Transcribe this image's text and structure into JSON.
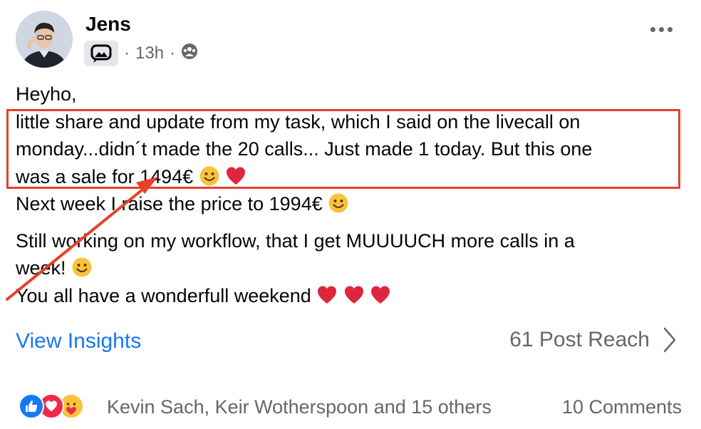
{
  "post": {
    "author": "Jens",
    "time": "13h",
    "separator": "·",
    "lines": {
      "greeting": "Heyho,",
      "line1": "little share and update from my task, which I said on the livecall on",
      "line2": "monday...didn´t made the 20 calls... Just made 1 today. But this one",
      "line3": "was a sale for 1494€",
      "line4": "Next week I raise the price to 1994€",
      "line5a": "Still working on my workflow, that I get MUUUUCH more calls in a",
      "line5b": "week!",
      "line6": "You all have a wonderfull  weekend"
    },
    "icons": [
      "group-icon",
      "audience-icon",
      "more-icon",
      "smile-emoji-icon",
      "heart-emoji-icon",
      "chevron-right-icon"
    ]
  },
  "footer": {
    "insights": "View Insights",
    "reach": "61 Post Reach",
    "reacted_by": "Kevin Sach, Keir Wotherspoon and 15 others",
    "comments": "10 Comments",
    "reaction_icons": [
      "like-icon",
      "love-icon",
      "care-icon"
    ]
  },
  "colors": {
    "link": "#1877f2",
    "secondary_text": "#65676b",
    "annotation": "#e8402a",
    "heart": "#e0263c",
    "emoji": "#f7c33b"
  }
}
